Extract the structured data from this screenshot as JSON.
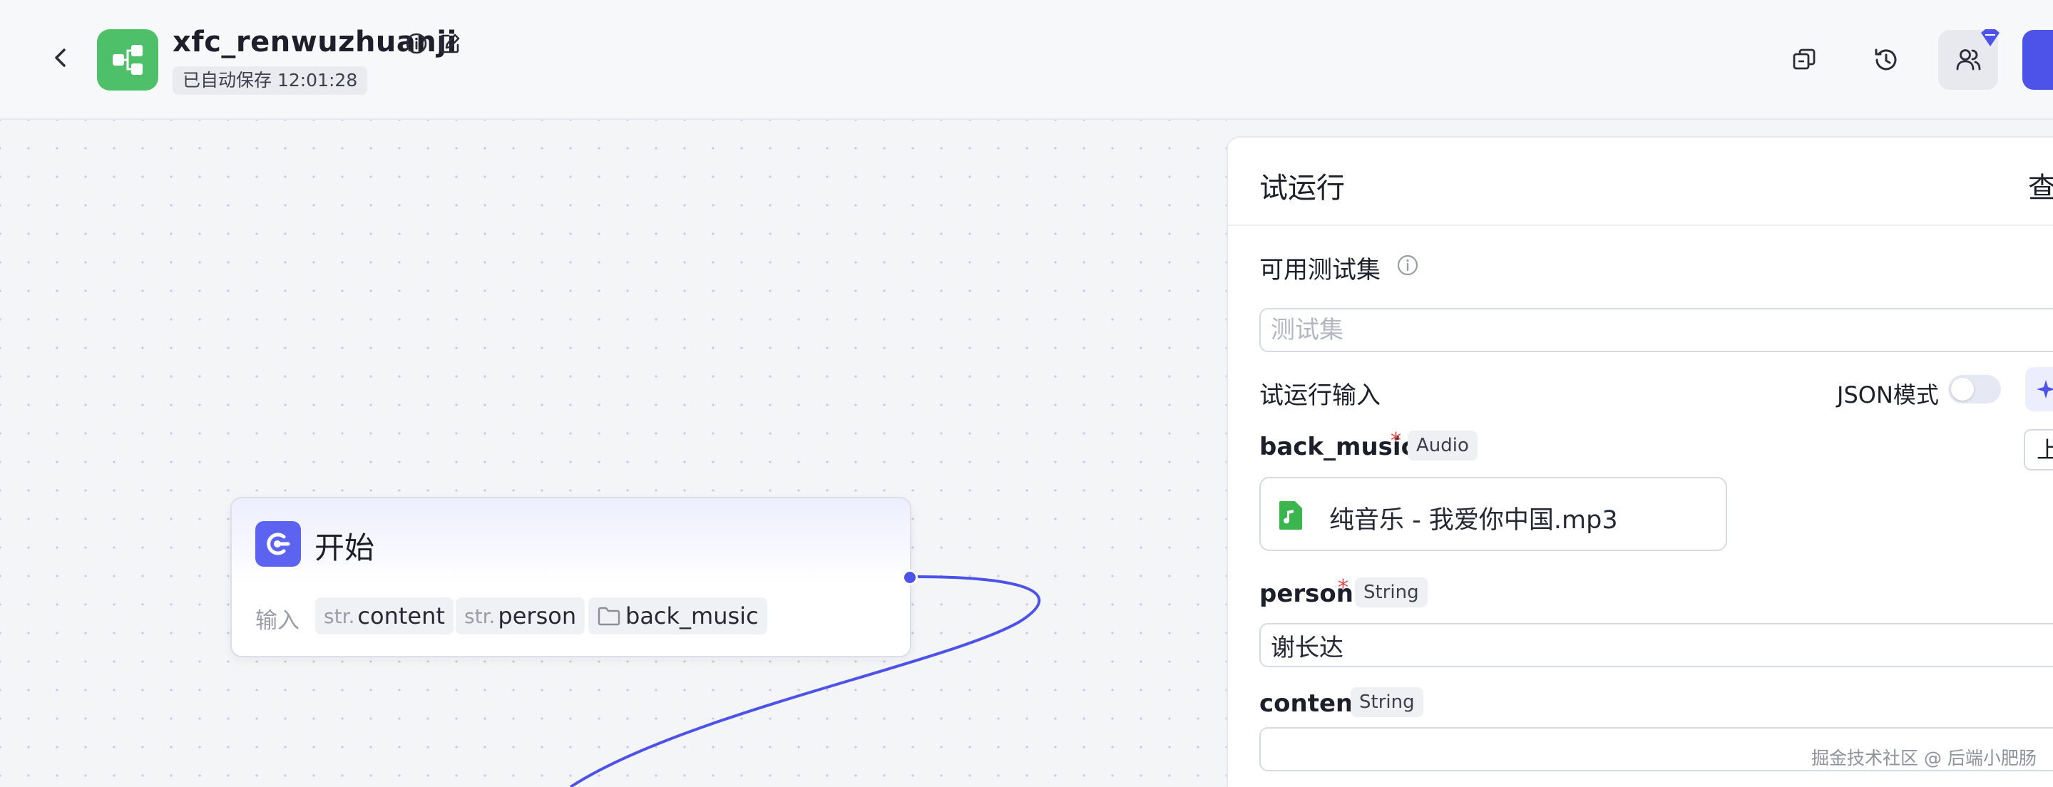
{
  "header": {
    "app_title": "xfc_renwuzhuanji",
    "save_status": "已自动保存 12:01:28"
  },
  "canvas": {
    "start_node": {
      "title": "开始",
      "input_label": "输入",
      "variables": [
        {
          "prefix": "str.",
          "name": "content"
        },
        {
          "prefix": "str.",
          "name": "person"
        },
        {
          "prefix": "",
          "name": "back_music"
        }
      ]
    }
  },
  "panel": {
    "title": "试运行",
    "right_action": "查",
    "testset": {
      "label": "可用测试集",
      "placeholder": "测试集"
    },
    "run_input": {
      "label": "试运行输入",
      "json_mode_label": "JSON模式",
      "upload_label": "上",
      "fields": {
        "back_music": {
          "name": "back_music",
          "type": "Audio",
          "file": "纯音乐 - 我爱你中国.mp3"
        },
        "person": {
          "name": "person",
          "type": "String",
          "value": "谢长达"
        },
        "content": {
          "name": "content",
          "type": "String",
          "value": ""
        }
      }
    }
  },
  "watermark": "掘金技术社区 @ 后端小肥肠",
  "colors": {
    "accent": "#4d53e8",
    "logo_green": "#4fc06a",
    "required": "#e5484d"
  }
}
